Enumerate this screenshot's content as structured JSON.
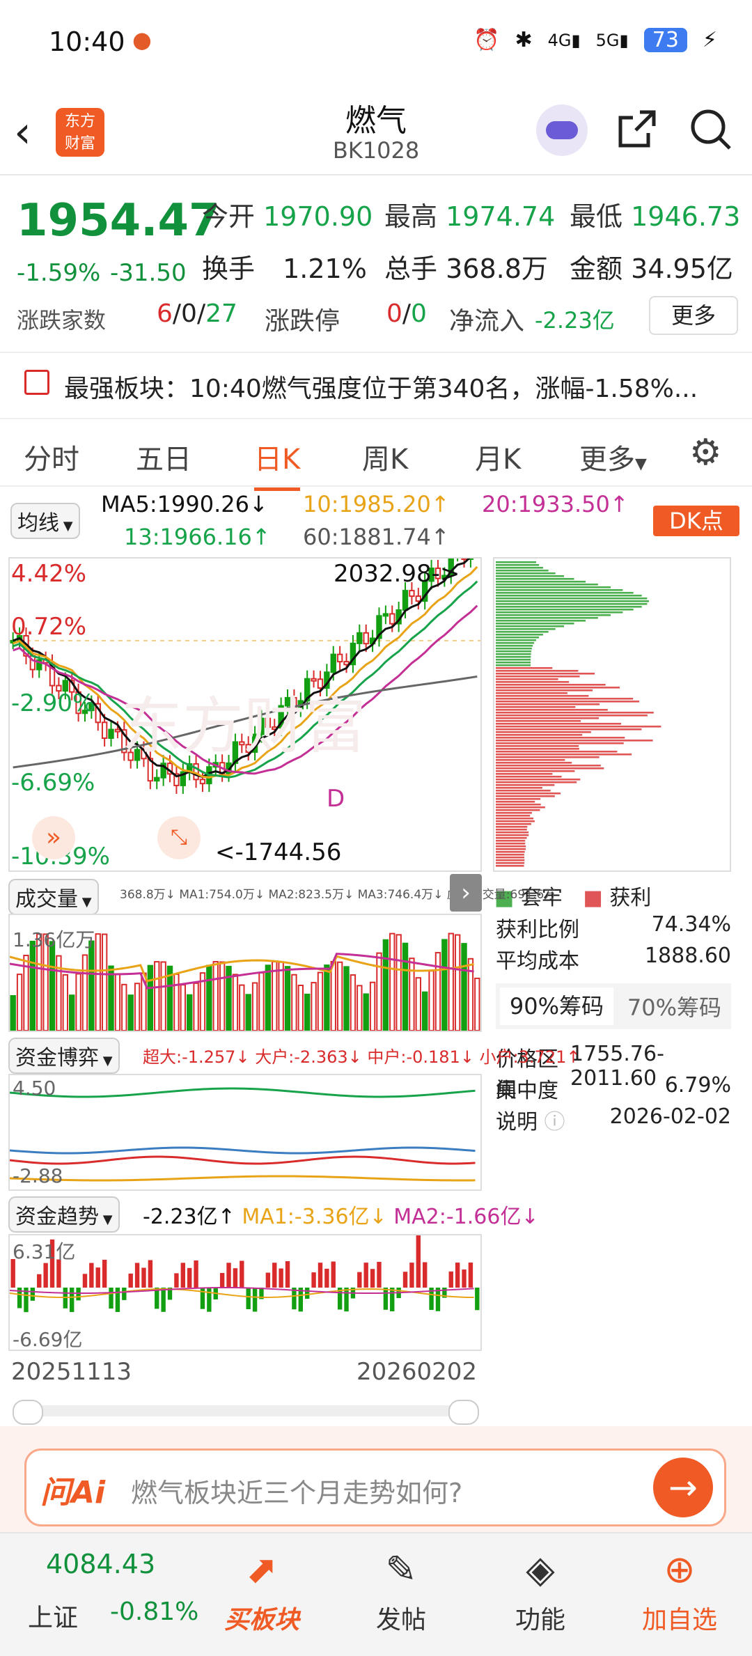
{
  "status": {
    "time": "10:40",
    "battery": "73"
  },
  "nav": {
    "title": "燃气",
    "code": "BK1028",
    "logo_line1": "东方",
    "logo_line2": "财富"
  },
  "quote": {
    "price": "1954.47",
    "change_pct": "-1.59%",
    "change": "-31.50",
    "open_label": "今开",
    "open": "1970.90",
    "high_label": "最高",
    "high": "1974.74",
    "low_label": "最低",
    "low": "1946.73",
    "turnover_label": "换手",
    "turnover": "1.21%",
    "volume_label": "总手",
    "volume": "368.8万",
    "amount_label": "金额",
    "amount": "34.95亿",
    "breadth_label": "涨跌家数",
    "up": "6",
    "flat": "0",
    "down": "27",
    "limit_label": "涨跌停",
    "limit_up": "0",
    "limit_down": "0",
    "inflow_label": "净流入",
    "inflow": "-2.23亿",
    "more": "更多"
  },
  "news": {
    "text": "最强板块：10:40燃气强度位于第340名，涨幅-1.58%..."
  },
  "tabs": [
    "分时",
    "五日",
    "日K",
    "周K",
    "月K",
    "更多"
  ],
  "active_tab": "日K",
  "ma": {
    "label": "均线",
    "ma5": "MA5:1990.26↓",
    "ma10": "10:1985.20↑",
    "ma20": "20:1933.50↑",
    "ma13": "13:1966.16↑",
    "ma60": "60:1881.74↑",
    "dk": "DK点"
  },
  "kline": {
    "y_labels": [
      "4.42%",
      "0.72%",
      "-2.90%",
      "-6.69%",
      "-10.39%"
    ],
    "high_mark": "2032.98->",
    "low_mark": "<-1744.56",
    "d_mark": "D",
    "watermark": "东方财富"
  },
  "chips": {
    "legend_trap": "套牢",
    "legend_profit": "获利",
    "rows": [
      {
        "k": "获利比例",
        "v": "74.34%"
      },
      {
        "k": "平均成本",
        "v": "1888.60"
      }
    ],
    "tab90": "90%筹码",
    "tab70": "70%筹码",
    "rows2": [
      {
        "k": "价格区间",
        "v": "1755.76-2011.60"
      },
      {
        "k": "集中度",
        "v": "6.79%"
      },
      {
        "k": "说明",
        "v": "2026-02-02"
      }
    ]
  },
  "volume": {
    "label": "成交量",
    "legend": "368.8万↓ MA1:754.0万↓ MA2:823.5万↓ MA3:746.4万↓ 虚拟成交量:691.6万",
    "y": "1.36亿万"
  },
  "fund": {
    "label": "资金博弈",
    "legend": "超大:-1.257↓ 大户:-2.363↓ 中户:-0.181↓ 小户:3.721↑",
    "y_top": "4.50",
    "y_bot": "-2.88"
  },
  "trend": {
    "label": "资金趋势",
    "val": "-2.23亿↑",
    "ma1": "MA1:-3.36亿↓",
    "ma2": "MA2:-1.66亿↓",
    "y_top": "6.31亿",
    "y_bot": "-6.69亿"
  },
  "dates": {
    "start": "20251113",
    "end": "20260202"
  },
  "ai": {
    "brand": "问Ai",
    "placeholder": "燃气板块近三个月走势如何?"
  },
  "bottom": {
    "index_value": "4084.43",
    "index_name": "上证",
    "index_change": "-0.81%",
    "buy": "买板块",
    "post": "发帖",
    "func": "功能",
    "add": "加自选"
  },
  "colors": {
    "accent": "#f05a24",
    "up": "#d92b2b",
    "down": "#16a34a"
  }
}
